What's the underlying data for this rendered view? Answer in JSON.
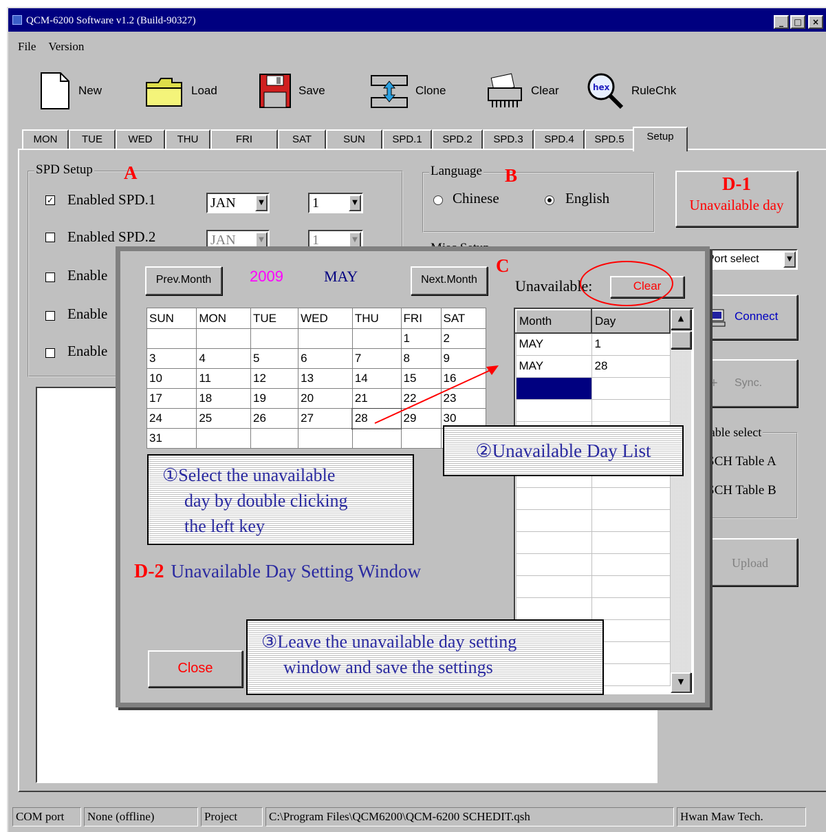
{
  "window": {
    "title": "QCM-6200 Software v1.2 (Build-90327)",
    "controls": [
      "_",
      "□",
      "×"
    ]
  },
  "menu": [
    "File",
    "Version"
  ],
  "toolbar": [
    {
      "label": "New",
      "icon": "new-file-icon"
    },
    {
      "label": "Load",
      "icon": "folder-icon"
    },
    {
      "label": "Save",
      "icon": "floppy-disk-icon"
    },
    {
      "label": "Clone",
      "icon": "clone-icon"
    },
    {
      "label": "Clear",
      "icon": "shredder-icon"
    },
    {
      "label": "RuleChk",
      "icon": "magnifier-icon",
      "icon_text": "hex"
    }
  ],
  "tabs": [
    "MON",
    "TUE",
    "WED",
    "THU",
    "FRI",
    "SAT",
    "SUN",
    "SPD.1",
    "SPD.2",
    "SPD.3",
    "SPD.4",
    "SPD.5",
    "Setup"
  ],
  "active_tab": "Setup",
  "spd_setup": {
    "title": "SPD Setup",
    "rows": [
      {
        "label": "Enabled SPD.1",
        "checked": true,
        "month": "JAN",
        "day": "1"
      },
      {
        "label": "Enabled SPD.2",
        "checked": false,
        "month": "JAN",
        "day": "1"
      },
      {
        "label": "Enable",
        "checked": false
      },
      {
        "label": "Enable",
        "checked": false
      },
      {
        "label": "Enable",
        "checked": false
      }
    ]
  },
  "language": {
    "title": "Language",
    "options": [
      "Chinese",
      "English"
    ],
    "selected": "English"
  },
  "misc_setup": {
    "title": "Misc Setup"
  },
  "right_panel": {
    "unavailable_day_button": "Unavailable day",
    "port_select": "Port select",
    "connect": "Connect",
    "sync": "Sync.",
    "table_select": {
      "title": "Table select",
      "options": [
        "SCH Table A",
        "SCH Table B"
      ]
    },
    "upload": "Upload"
  },
  "markers": {
    "a": "A",
    "b": "B",
    "c": "C",
    "d1": "D-1",
    "d2": "D-2",
    "d2_text": "Unavailable Day Setting Window"
  },
  "dialog": {
    "prev_month": "Prev.Month",
    "next_month": "Next.Month",
    "year": "2009",
    "month": "MAY",
    "unavailable_label": "Unavailable:",
    "clear_button": "Clear",
    "close_button": "Close",
    "weekdays": [
      "SUN",
      "MON",
      "TUE",
      "WED",
      "THU",
      "FRI",
      "SAT"
    ],
    "weeks": [
      [
        "",
        "",
        "",
        "",
        "",
        "1",
        "2"
      ],
      [
        "3",
        "4",
        "5",
        "6",
        "7",
        "8",
        "9"
      ],
      [
        "10",
        "11",
        "12",
        "13",
        "14",
        "15",
        "16"
      ],
      [
        "17",
        "18",
        "19",
        "20",
        "21",
        "22",
        "23"
      ],
      [
        "24",
        "25",
        "26",
        "27",
        "28",
        "29",
        "30"
      ],
      [
        "31",
        "",
        "",
        "",
        "",
        "",
        ""
      ]
    ],
    "focused_day": "28",
    "list_columns": [
      "Month",
      "Day"
    ],
    "list_rows": [
      {
        "month": "MAY",
        "day": "1"
      },
      {
        "month": "MAY",
        "day": "28"
      }
    ]
  },
  "callouts": {
    "c1_line1": "①Select the unavailable",
    "c1_line2": "day by double clicking",
    "c1_line3": "the left key",
    "c2": "②Unavailable Day List",
    "c3_line1": "③Leave the unavailable day setting",
    "c3_line2": "window and save the settings"
  },
  "statusbar": {
    "com_port_label": "COM port",
    "com_port_value": "None (offline)",
    "project_label": "Project",
    "project_path": "C:\\Program Files\\QCM6200\\QCM-6200 SCHEDIT.qsh",
    "vendor": "Hwan Maw Tech."
  },
  "colors": {
    "title_bar": "#000080",
    "annotation_red": "#ff0000",
    "year_magenta": "#ff00ff",
    "callout_text": "#2a2aa0",
    "selection": "#000080"
  }
}
